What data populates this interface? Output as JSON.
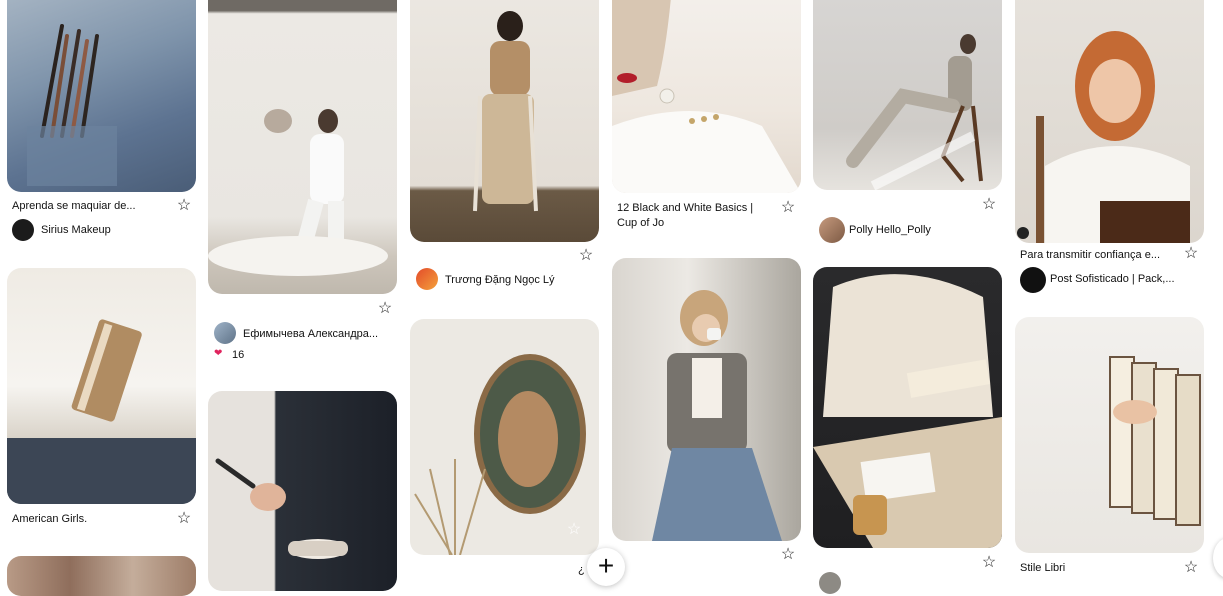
{
  "pins": [
    {
      "id": "p1",
      "title": "Aprenda se maquiar de...",
      "author": "Sirius Makeup",
      "colors": [
        "#9fb0c0",
        "#5b7190",
        "#3a3430"
      ]
    },
    {
      "id": "p2",
      "title": "American Girls.",
      "colors": [
        "#f2efe9",
        "#d9cfc1",
        "#3d4552"
      ]
    },
    {
      "id": "p3",
      "colors": [
        "#b89a86",
        "#8f6e5c",
        "#c4ad9b"
      ]
    },
    {
      "id": "p4",
      "author": "Ефимычева Александра...",
      "likes": "16",
      "colors": [
        "#ece9e4",
        "#d9d4cc",
        "#bfb8ad"
      ]
    },
    {
      "id": "p5",
      "colors": [
        "#2b3038",
        "#dcd6cf",
        "#1c2028"
      ]
    },
    {
      "id": "p6",
      "author": "Trương Đặng Ngọc Lý",
      "colors": [
        "#e8e3dc",
        "#b89a76",
        "#6b5a46"
      ]
    },
    {
      "id": "p7",
      "colors": [
        "#ece9e3",
        "#8a6a46",
        "#c6b59b"
      ]
    },
    {
      "id": "p8",
      "title": "12 Black and White Basics | Cup of Jo",
      "colors": [
        "#f4f0ec",
        "#e7dfd6",
        "#c9b6a3"
      ]
    },
    {
      "id": "p9",
      "colors": [
        "#8d8d88",
        "#d9d5cf",
        "#6f87a3"
      ]
    },
    {
      "id": "p10",
      "author": "Polly Hello_Polly",
      "colors": [
        "#d8d6d4",
        "#b5b0a8",
        "#8c8478"
      ]
    },
    {
      "id": "p11",
      "colors": [
        "#1f1f21",
        "#e6dccc",
        "#d9c9b0"
      ]
    },
    {
      "id": "p12",
      "title": "Para transmitir confiança e...",
      "author": "Post Sofisticado | Pack,...",
      "colors": [
        "#e6e2dc",
        "#7a5233",
        "#4b2a18"
      ]
    },
    {
      "id": "p13",
      "title": "Stile Libri",
      "colors": [
        "#f2f0ed",
        "#ddd8d1",
        "#8b6f57"
      ]
    }
  ],
  "fab_label": "+",
  "partial_text": "¿"
}
